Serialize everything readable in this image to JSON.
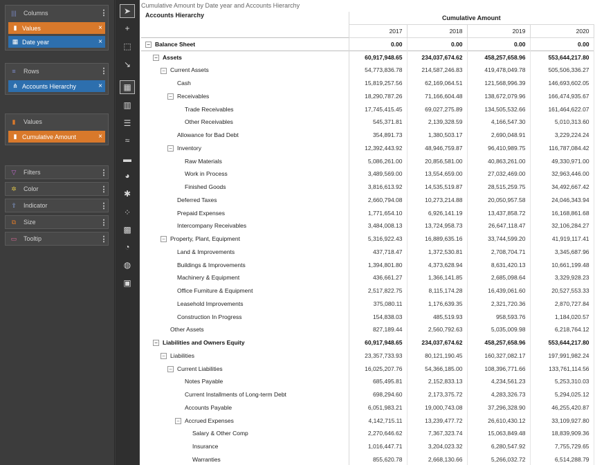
{
  "fields": {
    "columns": {
      "label": "Columns",
      "pills": [
        {
          "label": "Values",
          "icon": "bar-chart-icon",
          "color": "#d9792b"
        },
        {
          "label": "Date year",
          "icon": "date-icon",
          "color": "#2d6fae"
        }
      ]
    },
    "rows": {
      "label": "Rows",
      "pills": [
        {
          "label": "Accounts Hierarchy",
          "icon": "hierarchy-icon",
          "color": "#2d6fae"
        }
      ]
    },
    "values": {
      "label": "Values",
      "pills": [
        {
          "label": "Cumulative Amount",
          "icon": "bar-chart-icon",
          "color": "#d9792b"
        }
      ]
    },
    "marks": [
      {
        "label": "Filters",
        "icon": "filter-icon"
      },
      {
        "label": "Color",
        "icon": "palette-icon"
      },
      {
        "label": "Indicator",
        "icon": "indicator-icon"
      },
      {
        "label": "Size",
        "icon": "size-icon"
      },
      {
        "label": "Tooltip",
        "icon": "tooltip-icon"
      }
    ]
  },
  "toolbar": [
    "pointer-tool",
    "crosshair-tool",
    "select-tool",
    "drill-tool",
    "table-chart",
    "bar-chart",
    "text-chart",
    "line-chart",
    "area-chart",
    "pie-chart",
    "radar-chart",
    "scatter-chart",
    "treemap-chart",
    "gauge-chart",
    "globe-chart",
    "image-tool"
  ],
  "table": {
    "caption": "Cumulative Amount by Date year and Accounts Hierarchy",
    "row_header": "Accounts Hierarchy",
    "measure": "Cumulative Amount",
    "years": [
      "2017",
      "2018",
      "2019",
      "2020"
    ],
    "rows": [
      {
        "label": "Balance Sheet",
        "level": 0,
        "toggle": "−",
        "bold": true,
        "values": [
          "0.00",
          "0.00",
          "0.00",
          "0.00"
        ]
      },
      {
        "label": "Assets",
        "level": 1,
        "toggle": "−",
        "bold": true,
        "values": [
          "60,917,948.65",
          "234,037,674.62",
          "458,257,658.96",
          "553,644,217.80"
        ]
      },
      {
        "label": "Current Assets",
        "level": 2,
        "toggle": "−",
        "bold": false,
        "values": [
          "54,773,836.78",
          "214,587,246.83",
          "419,478,049.78",
          "505,506,336.27"
        ]
      },
      {
        "label": "Cash",
        "level": 3,
        "toggle": "",
        "bold": false,
        "values": [
          "15,819,257.56",
          "62,169,064.51",
          "121,568,996.39",
          "146,693,602.05"
        ]
      },
      {
        "label": "Receivables",
        "level": 3,
        "toggle": "−",
        "bold": false,
        "values": [
          "18,290,787.26",
          "71,166,604.48",
          "138,672,079.96",
          "166,474,935.67"
        ]
      },
      {
        "label": "Trade Receivables",
        "level": 4,
        "toggle": "",
        "bold": false,
        "values": [
          "17,745,415.45",
          "69,027,275.89",
          "134,505,532.66",
          "161,464,622.07"
        ]
      },
      {
        "label": "Other Receivables",
        "level": 4,
        "toggle": "",
        "bold": false,
        "values": [
          "545,371.81",
          "2,139,328.59",
          "4,166,547.30",
          "5,010,313.60"
        ]
      },
      {
        "label": "Allowance for Bad Debt",
        "level": 3,
        "toggle": "",
        "bold": false,
        "values": [
          "354,891.73",
          "1,380,503.17",
          "2,690,048.91",
          "3,229,224.24"
        ]
      },
      {
        "label": "Inventory",
        "level": 3,
        "toggle": "−",
        "bold": false,
        "values": [
          "12,392,443.92",
          "48,946,759.87",
          "96,410,989.75",
          "116,787,084.42"
        ]
      },
      {
        "label": "Raw Materials",
        "level": 4,
        "toggle": "",
        "bold": false,
        "values": [
          "5,086,261.00",
          "20,856,581.00",
          "40,863,261.00",
          "49,330,971.00"
        ]
      },
      {
        "label": "Work in Process",
        "level": 4,
        "toggle": "",
        "bold": false,
        "values": [
          "3,489,569.00",
          "13,554,659.00",
          "27,032,469.00",
          "32,963,446.00"
        ]
      },
      {
        "label": "Finished Goods",
        "level": 4,
        "toggle": "",
        "bold": false,
        "values": [
          "3,816,613.92",
          "14,535,519.87",
          "28,515,259.75",
          "34,492,667.42"
        ]
      },
      {
        "label": "Deferred Taxes",
        "level": 3,
        "toggle": "",
        "bold": false,
        "values": [
          "2,660,794.08",
          "10,273,214.88",
          "20,050,957.58",
          "24,046,343.94"
        ]
      },
      {
        "label": "Prepaid Expenses",
        "level": 3,
        "toggle": "",
        "bold": false,
        "values": [
          "1,771,654.10",
          "6,926,141.19",
          "13,437,858.72",
          "16,168,861.68"
        ]
      },
      {
        "label": "Intercompany Receivables",
        "level": 3,
        "toggle": "",
        "bold": false,
        "values": [
          "3,484,008.13",
          "13,724,958.73",
          "26,647,118.47",
          "32,106,284.27"
        ]
      },
      {
        "label": "Property, Plant, Equipment",
        "level": 2,
        "toggle": "−",
        "bold": false,
        "values": [
          "5,316,922.43",
          "16,889,635.16",
          "33,744,599.20",
          "41,919,117.41"
        ]
      },
      {
        "label": "Land & Improvements",
        "level": 3,
        "toggle": "",
        "bold": false,
        "values": [
          "437,718.47",
          "1,372,530.81",
          "2,708,704.71",
          "3,345,687.96"
        ]
      },
      {
        "label": "Buildings & Improvements",
        "level": 3,
        "toggle": "",
        "bold": false,
        "values": [
          "1,394,801.80",
          "4,373,628.94",
          "8,631,420.13",
          "10,661,199.48"
        ]
      },
      {
        "label": "Machinery & Equipment",
        "level": 3,
        "toggle": "",
        "bold": false,
        "values": [
          "436,661.27",
          "1,366,141.85",
          "2,685,098.64",
          "3,329,928.23"
        ]
      },
      {
        "label": "Office Furniture & Equipment",
        "level": 3,
        "toggle": "",
        "bold": false,
        "values": [
          "2,517,822.75",
          "8,115,174.28",
          "16,439,061.60",
          "20,527,553.33"
        ]
      },
      {
        "label": "Leasehold Improvements",
        "level": 3,
        "toggle": "",
        "bold": false,
        "values": [
          "375,080.11",
          "1,176,639.35",
          "2,321,720.36",
          "2,870,727.84"
        ]
      },
      {
        "label": "Construction In Progress",
        "level": 3,
        "toggle": "",
        "bold": false,
        "values": [
          "154,838.03",
          "485,519.93",
          "958,593.76",
          "1,184,020.57"
        ]
      },
      {
        "label": "Other Assets",
        "level": 2,
        "toggle": "",
        "bold": false,
        "values": [
          "827,189.44",
          "2,560,792.63",
          "5,035,009.98",
          "6,218,764.12"
        ]
      },
      {
        "label": "Liabilities and Owners Equity",
        "level": 1,
        "toggle": "−",
        "bold": true,
        "values": [
          "60,917,948.65",
          "234,037,674.62",
          "458,257,658.96",
          "553,644,217.80"
        ]
      },
      {
        "label": "Liabilities",
        "level": 2,
        "toggle": "−",
        "bold": false,
        "values": [
          "23,357,733.93",
          "80,121,190.45",
          "160,327,082.17",
          "197,991,982.24"
        ]
      },
      {
        "label": "Current Liabilities",
        "level": 3,
        "toggle": "−",
        "bold": false,
        "values": [
          "16,025,207.76",
          "54,366,185.00",
          "108,396,771.66",
          "133,761,114.56"
        ]
      },
      {
        "label": "Notes Payable",
        "level": 4,
        "toggle": "",
        "bold": false,
        "values": [
          "685,495.81",
          "2,152,833.13",
          "4,234,561.23",
          "5,253,310.03"
        ]
      },
      {
        "label": "Current Installments of Long-term Debt",
        "level": 4,
        "toggle": "",
        "bold": false,
        "values": [
          "698,294.60",
          "2,173,375.72",
          "4,283,326.73",
          "5,294,025.12"
        ]
      },
      {
        "label": "Accounts Payable",
        "level": 4,
        "toggle": "",
        "bold": false,
        "values": [
          "6,051,983.21",
          "19,000,743.08",
          "37,296,328.90",
          "46,255,420.87"
        ]
      },
      {
        "label": "Accrued Expenses",
        "level": 4,
        "toggle": "−",
        "bold": false,
        "values": [
          "4,142,715.11",
          "13,239,477.72",
          "26,610,430.12",
          "33,109,927.80"
        ]
      },
      {
        "label": "Salary & Other Comp",
        "level": 5,
        "toggle": "",
        "bold": false,
        "values": [
          "2,270,646.62",
          "7,367,323.74",
          "15,063,849.48",
          "18,839,909.36"
        ]
      },
      {
        "label": "Insurance",
        "level": 5,
        "toggle": "",
        "bold": false,
        "values": [
          "1,016,447.71",
          "3,204,023.32",
          "6,280,547.92",
          "7,755,729.65"
        ]
      },
      {
        "label": "Warranties",
        "level": 5,
        "toggle": "",
        "bold": false,
        "values": [
          "855,620.78",
          "2,668,130.66",
          "5,266,032.72",
          "6,514,288.79"
        ]
      }
    ]
  }
}
